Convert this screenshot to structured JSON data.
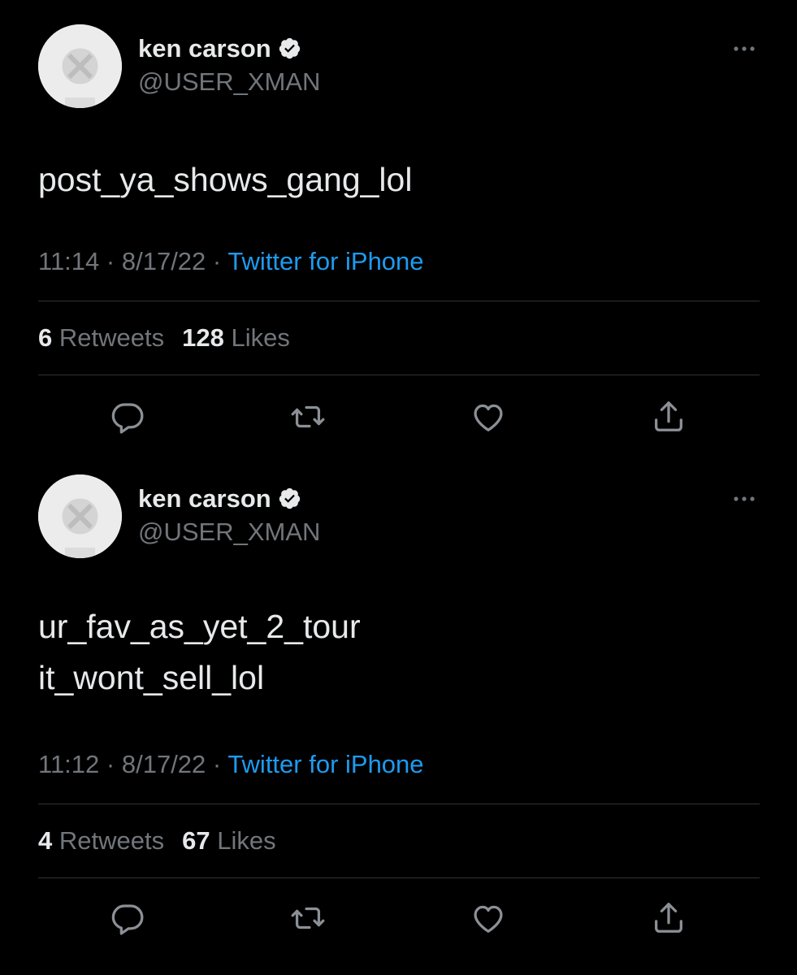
{
  "theme": {
    "background": "#000000",
    "text_primary": "#e7e9ea",
    "text_secondary": "#71767b",
    "link": "#1d9bf0",
    "divider": "#2f3336"
  },
  "tweets": [
    {
      "author": {
        "name": "ken carson",
        "handle": "@USER_XMAN",
        "verified": true
      },
      "text_lines": [
        "post_ya_shows_gang_lol"
      ],
      "time": "11:14",
      "date": "8/17/22",
      "source": "Twitter for iPhone",
      "sep": "·",
      "retweets_count": "6",
      "retweets_label": "Retweets",
      "likes_count": "128",
      "likes_label": "Likes",
      "icons": [
        "reply-icon",
        "retweet-icon",
        "like-icon",
        "share-icon",
        "more-icon",
        "verified-icon"
      ]
    },
    {
      "author": {
        "name": "ken carson",
        "handle": "@USER_XMAN",
        "verified": true
      },
      "text_lines": [
        "ur_fav_as_yet_2_tour",
        "it_wont_sell_lol"
      ],
      "time": "11:12",
      "date": "8/17/22",
      "source": "Twitter for iPhone",
      "sep": "·",
      "retweets_count": "4",
      "retweets_label": "Retweets",
      "likes_count": "67",
      "likes_label": "Likes",
      "icons": [
        "reply-icon",
        "retweet-icon",
        "like-icon",
        "share-icon",
        "more-icon",
        "verified-icon"
      ]
    }
  ]
}
